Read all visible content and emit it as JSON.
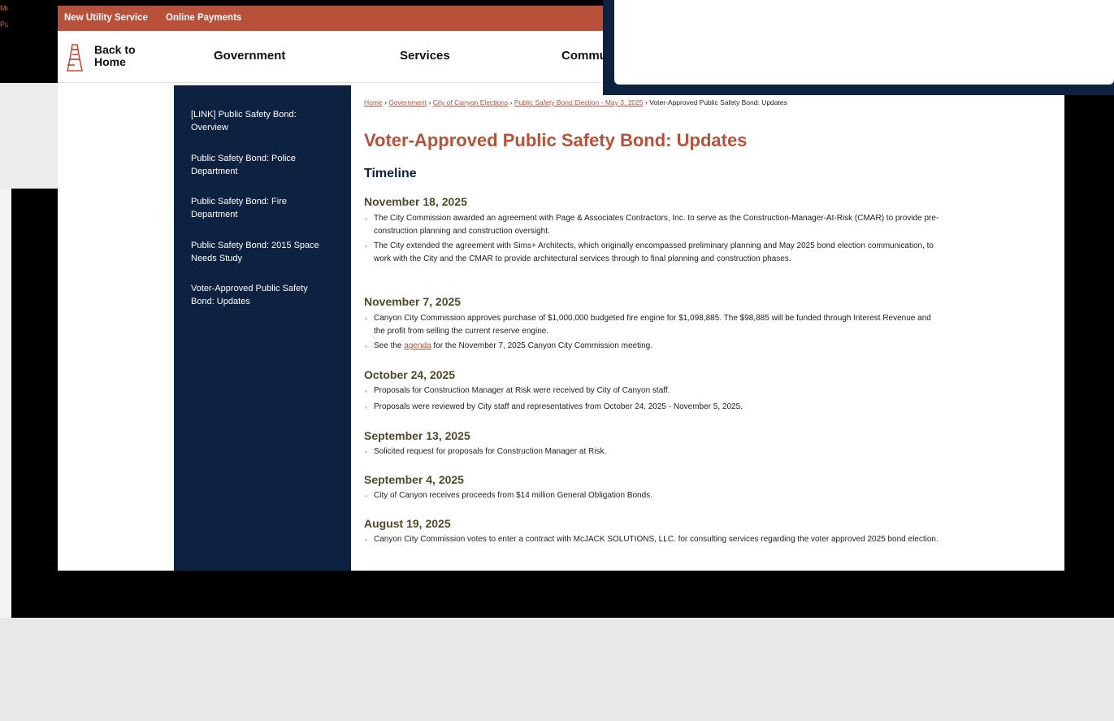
{
  "clipped_left_text": [
    "Mu",
    "Pu"
  ],
  "topbar": {
    "links": [
      "New Utility Service",
      "Online Payments"
    ]
  },
  "navbar": {
    "home_label": "Back to Home",
    "items": [
      "Government",
      "Services",
      "Commu"
    ]
  },
  "logo_icon": "city-tower-logo-icon",
  "sidebar": {
    "items": [
      "[LINK] Public Safety Bond: Overview",
      "Public Safety Bond: Police Department",
      "Public Safety Bond: Fire Department",
      "Public Safety Bond: 2015 Space Needs Study",
      "Voter-Approved Public Safety Bond: Updates"
    ]
  },
  "breadcrumb": {
    "links": [
      "Home",
      "Government",
      "City of Canyon Elections",
      "Public Safety Bond Election - May 3, 2025"
    ],
    "separator": "›",
    "current": "Voter-Approved Public Safety Bond: Updates"
  },
  "page": {
    "title": "Voter-Approved Public Safety Bond: Updates",
    "timeline_heading": "Timeline"
  },
  "timeline": [
    {
      "date": "November 18, 2025",
      "items": [
        "The City Commission awarded an agreement with Page & Associates Contractors, Inc. to serve as the Construction-Manager-At-Risk (CMAR) to provide pre-construction planning and construction oversight.",
        "The City extended the agreement with Sims+ Architects, which originally encompassed preliminary planning and May 2025 bond election communication, to work with the City and the CMAR to provide architectural services through to final planning and construction phases."
      ]
    },
    {
      "date": "November 7, 2025",
      "items": [
        "Canyon City Commission approves purchase of $1,000,000 budgeted fire engine for $1,098,885. The $98,885 will be funded through Interest Revenue and the profit from selling the current reserve engine."
      ],
      "agenda_item": {
        "before": "See the ",
        "link": "agenda",
        "after": " for the November 7, 2025 Canyon City Commission meeting."
      }
    },
    {
      "date": "October 24, 2025",
      "items": [
        "Proposals for Construction Manager at Risk were received by City of Canyon staff.",
        "Proposals were reviewed by City staff and representatives from October 24, 2025 - November 5, 2025."
      ]
    },
    {
      "date": "September 13, 2025",
      "items": [
        "Solicited request for proposals for Construction Manager at Risk."
      ]
    },
    {
      "date": "September 4, 2025",
      "items": [
        "City of Canyon receives proceeds from $14 million General Obligation Bonds."
      ]
    },
    {
      "date": "August 19, 2025",
      "items": [
        "Canyon City Commission votes to enter a contract with McJACK SOLUTIONS, LLC. for consulting services regarding the voter approved 2025 bond election."
      ]
    }
  ],
  "colors": {
    "brand": "#b9513a",
    "navy": "#0d2240",
    "date_heading": "#4e4a2a"
  }
}
